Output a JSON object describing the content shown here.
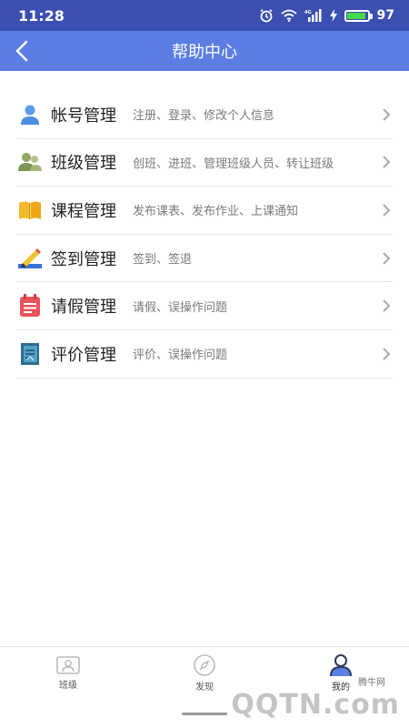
{
  "status_bar": {
    "time": "11:28",
    "battery_level": "97",
    "icons": [
      "alarm-icon",
      "wifi-icon",
      "signal-4g-icon",
      "charging-icon",
      "battery-icon"
    ]
  },
  "header": {
    "title": "帮助中心",
    "back_icon": "chevron-left-icon"
  },
  "menu": {
    "items": [
      {
        "title": "帐号管理",
        "desc": "注册、登录、修改个人信息",
        "icon": "user-icon"
      },
      {
        "title": "班级管理",
        "desc": "创班、进班、管理班级人员、转让班级",
        "icon": "users-icon"
      },
      {
        "title": "课程管理",
        "desc": "发布课表、发布作业、上课通知",
        "icon": "book-icon"
      },
      {
        "title": "签到管理",
        "desc": "签到、签退",
        "icon": "pencil-icon"
      },
      {
        "title": "请假管理",
        "desc": "请假、误操作问题",
        "icon": "calendar-note-icon"
      },
      {
        "title": "评价管理",
        "desc": "评价、误操作问题",
        "icon": "notebook-icon"
      }
    ]
  },
  "bottom_nav": {
    "items": [
      {
        "label": "班级",
        "icon": "class-card-icon"
      },
      {
        "label": "发现",
        "icon": "compass-icon"
      },
      {
        "label": "我的",
        "icon": "person-icon"
      }
    ]
  },
  "watermark": {
    "small": "腾牛网",
    "big": "QQTN.com"
  },
  "colors": {
    "status_bar": "#3a4fb0",
    "app_bar": "#5b7de4",
    "divider": "#e6e6e6",
    "desc_text": "#7a7a7a"
  }
}
